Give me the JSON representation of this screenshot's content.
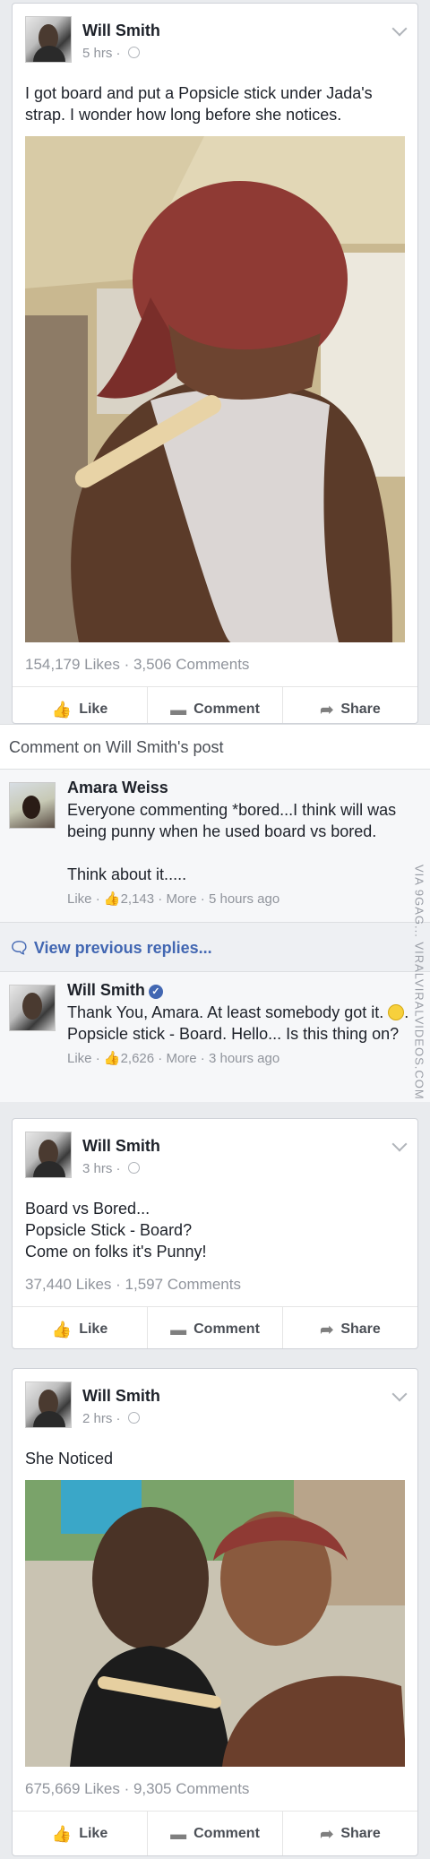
{
  "posts": [
    {
      "author": "Will Smith",
      "time": "5 hrs",
      "text": "I got board and put a Popsicle stick under Jada's strap. I wonder how long before she notices.",
      "stats": "154,179 Likes · 3,506 Comments"
    },
    {
      "author": "Will Smith",
      "time": "3 hrs",
      "text": "Board vs Bored...\nPopsicle Stick - Board?\nCome on folks it's Punny!",
      "stats": "37,440 Likes · 1,597 Comments"
    },
    {
      "author": "Will Smith",
      "time": "2 hrs",
      "text": "She Noticed",
      "stats": "675,669 Likes · 9,305 Comments"
    }
  ],
  "actions": {
    "like": "Like",
    "comment": "Comment",
    "share": "Share"
  },
  "comment_section": {
    "header": "Comment on Will Smith's post",
    "view_previous": "View previous replies...",
    "comments": [
      {
        "name": "Amara Weiss",
        "text": "Everyone commenting *bored...I think will was being punny when he used board vs bored.\n\nThink about it.....",
        "like": "Like",
        "likes": "2,143",
        "more": "More",
        "time": "5 hours ago"
      },
      {
        "name": "Will Smith",
        "text_before": "Thank You, Amara. At least somebody got it. ",
        "text_after": ". Popsicle stick - Board. Hello... Is this thing on?",
        "like": "Like",
        "likes": "2,626",
        "more": "More",
        "time": "3 hours ago"
      }
    ]
  },
  "watermark": "VIA 9GAG... VIRALVIRALVIDEOS.COM",
  "icons": {
    "like": "thumbs-up-icon",
    "comment": "speech-bubble-icon",
    "share": "share-arrow-icon",
    "globe": "globe-icon",
    "menu": "chevron-down-icon",
    "verified": "verified-badge-icon",
    "emoji": "smile-emoji-icon"
  },
  "colors": {
    "link": "#4267b2",
    "meta": "#90949c",
    "background": "#e9ebee"
  }
}
